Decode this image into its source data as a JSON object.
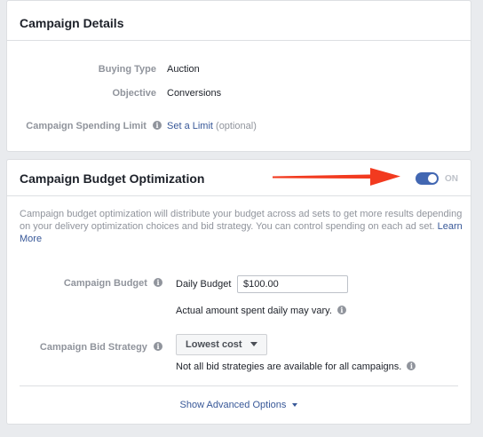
{
  "campaign_details": {
    "title": "Campaign Details",
    "buying_type_label": "Buying Type",
    "buying_type_value": "Auction",
    "objective_label": "Objective",
    "objective_value": "Conversions",
    "spending_limit_label": "Campaign Spending Limit",
    "spending_limit_link": "Set a Limit",
    "spending_limit_optional": "(optional)"
  },
  "budget_optimization": {
    "title": "Campaign Budget Optimization",
    "toggle_state": "ON",
    "description": "Campaign budget optimization will distribute your budget across ad sets to get more results depending on your delivery optimization choices and bid strategy. You can control spending on each ad set.",
    "learn_more": "Learn More",
    "budget_label": "Campaign Budget",
    "budget_type": "Daily Budget",
    "budget_value": "$100.00",
    "budget_note": "Actual amount spent daily may vary.",
    "bid_strategy_label": "Campaign Bid Strategy",
    "bid_strategy_value": "Lowest cost",
    "bid_strategy_note": "Not all bid strategies are available for all campaigns.",
    "advanced_options": "Show Advanced Options"
  },
  "icons": {
    "info": "i"
  },
  "colors": {
    "accent": "#4267b2",
    "link": "#385898",
    "arrow": "#f23a1f"
  }
}
